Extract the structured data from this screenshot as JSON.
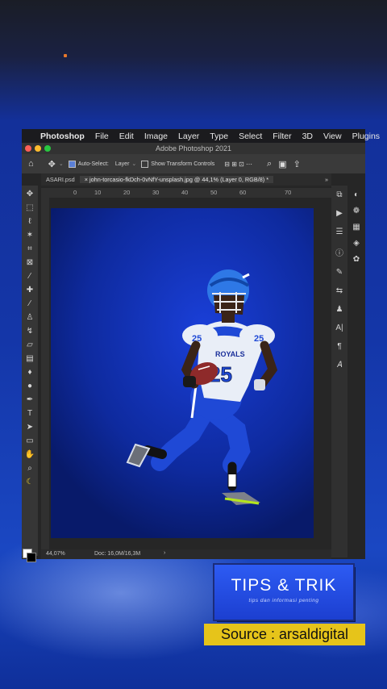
{
  "menubar": {
    "app_name": "Photoshop",
    "items": [
      "File",
      "Edit",
      "Image",
      "Layer",
      "Type",
      "Select",
      "Filter",
      "3D",
      "View",
      "Plugins"
    ]
  },
  "window": {
    "title": "Adobe Photoshop 2021"
  },
  "options_bar": {
    "auto_select_label": "Auto-Select:",
    "auto_select_value": "Layer",
    "show_transform_label": "Show Transform Controls"
  },
  "tabs": [
    {
      "label": "ASARI.psd"
    },
    {
      "label": "john-torcasio-fkDch-0vNfY-unsplash.jpg @ 44,1% (Layer 0, RGB/8) *"
    }
  ],
  "ruler": {
    "ticks": [
      "0",
      "10",
      "20",
      "30",
      "40",
      "50",
      "60",
      "70"
    ]
  },
  "status": {
    "zoom": "44,07%",
    "doc": "Doc: 16,0M/16,3M",
    "arrow": "›"
  },
  "overlay": {
    "tips_title": "TIPS & TRIK",
    "tips_subtitle": "tips dan informasi penting",
    "source_text": "Source : arsaldigital"
  },
  "jersey": {
    "team": "ROYALS",
    "number": "25"
  },
  "colors": {
    "canvas_blue": "#1a3fd8",
    "label_yellow": "#e6c41a",
    "tips_blue": "#2d5bf3"
  }
}
